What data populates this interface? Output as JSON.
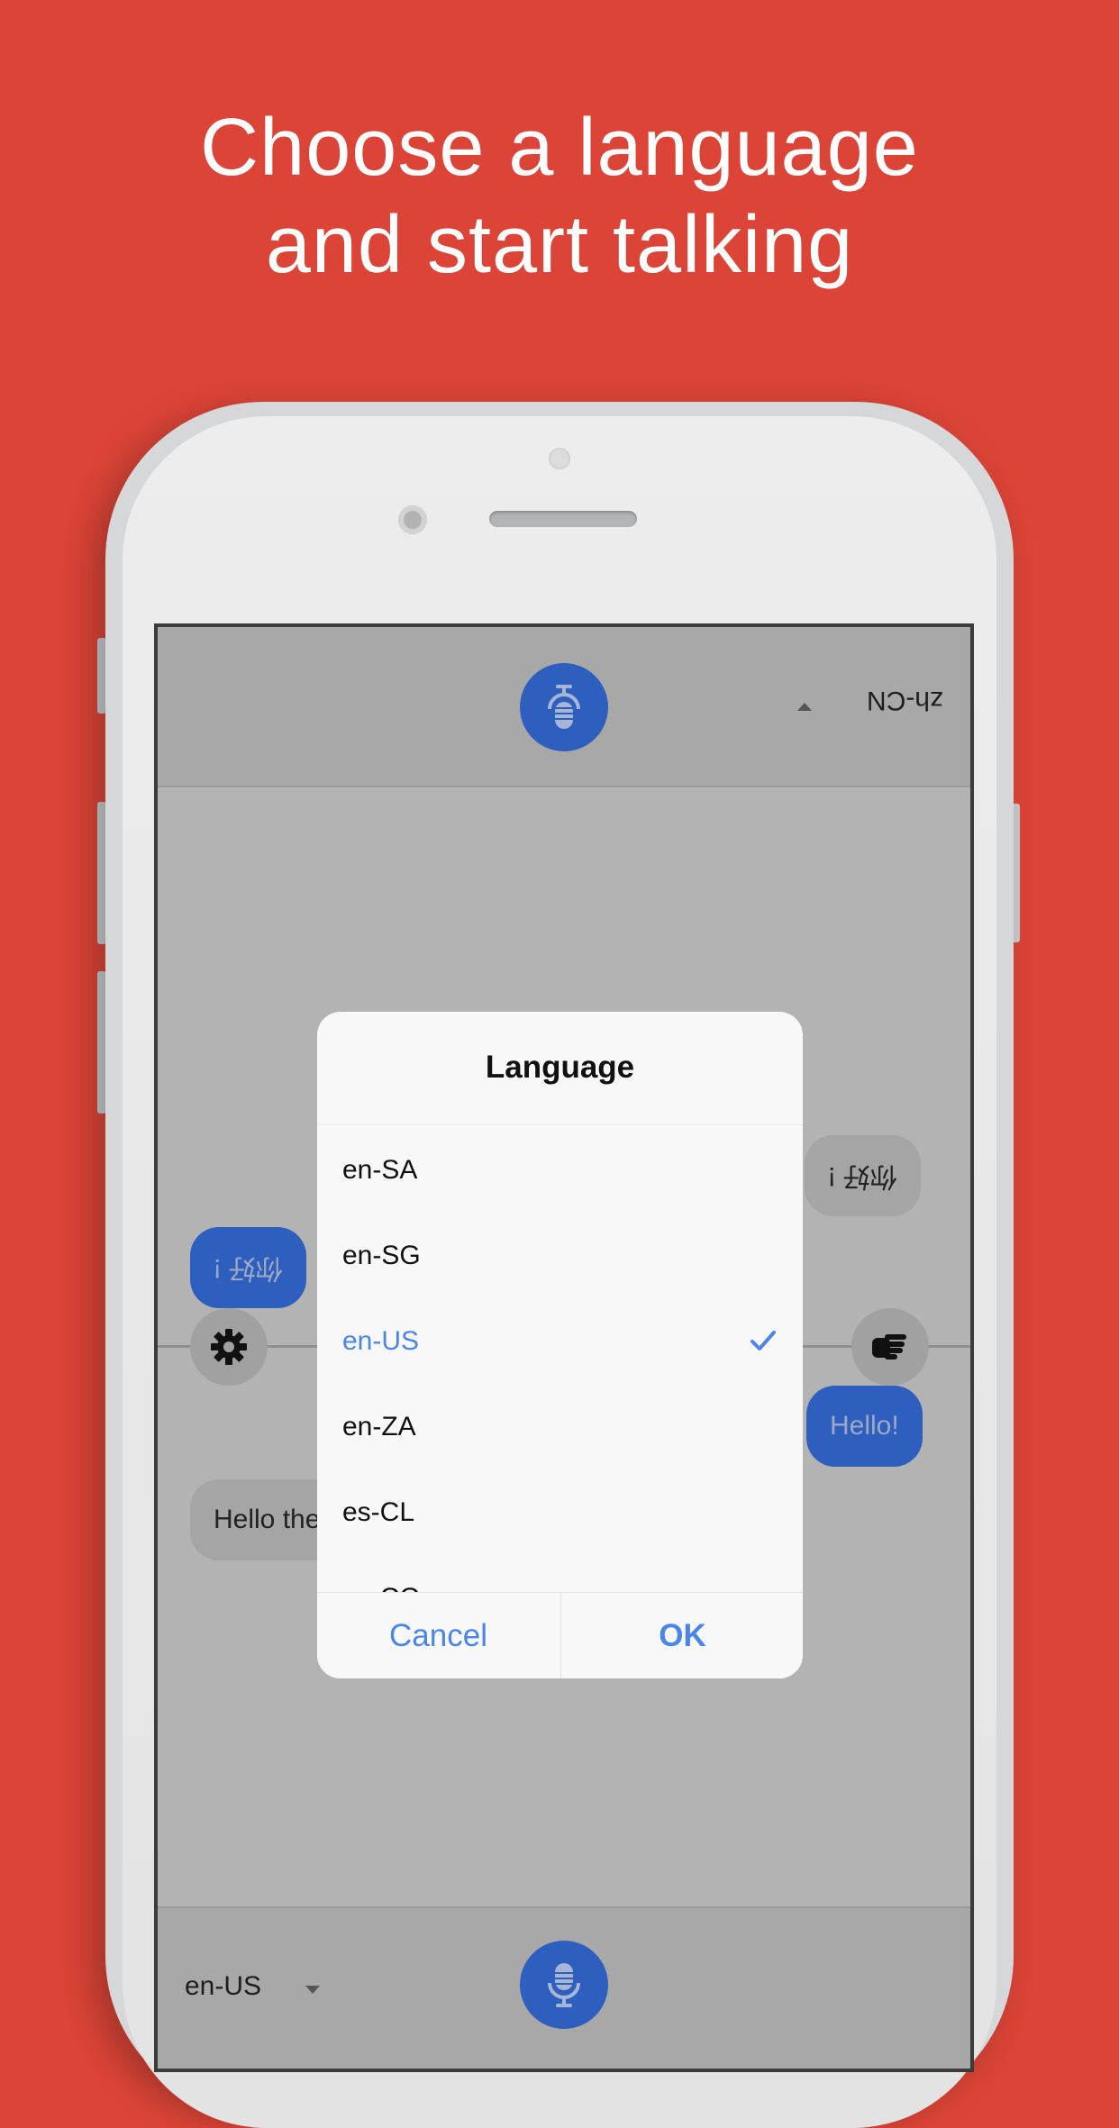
{
  "headline": {
    "line1": "Choose a language",
    "line2": "and start talking"
  },
  "app": {
    "top_language": "zh-CN",
    "bottom_language": "en-US",
    "messages": [
      {
        "text": "你好 !",
        "style": "gray",
        "flipped": true
      },
      {
        "text": "你好 !",
        "style": "blue",
        "flipped": true
      },
      {
        "text": "Hello!",
        "style": "blue",
        "flipped": false
      },
      {
        "text": "Hello there",
        "style": "gray",
        "flipped": false
      }
    ],
    "icons": {
      "top_mic": "microphone-icon",
      "bottom_mic": "microphone-icon",
      "settings": "gear-icon",
      "hand": "hand-pointing-icon"
    }
  },
  "dialog": {
    "title": "Language",
    "options": [
      {
        "label": "en-SA",
        "selected": false
      },
      {
        "label": "en-SG",
        "selected": false
      },
      {
        "label": "en-US",
        "selected": true
      },
      {
        "label": "en-ZA",
        "selected": false
      },
      {
        "label": "es-CL",
        "selected": false
      },
      {
        "label": "es-CO",
        "selected": false
      }
    ],
    "cancel_label": "Cancel",
    "ok_label": "OK"
  },
  "colors": {
    "background": "#db4437",
    "accent_blue": "#2f5fbe",
    "selected_text": "#4a86e8"
  }
}
